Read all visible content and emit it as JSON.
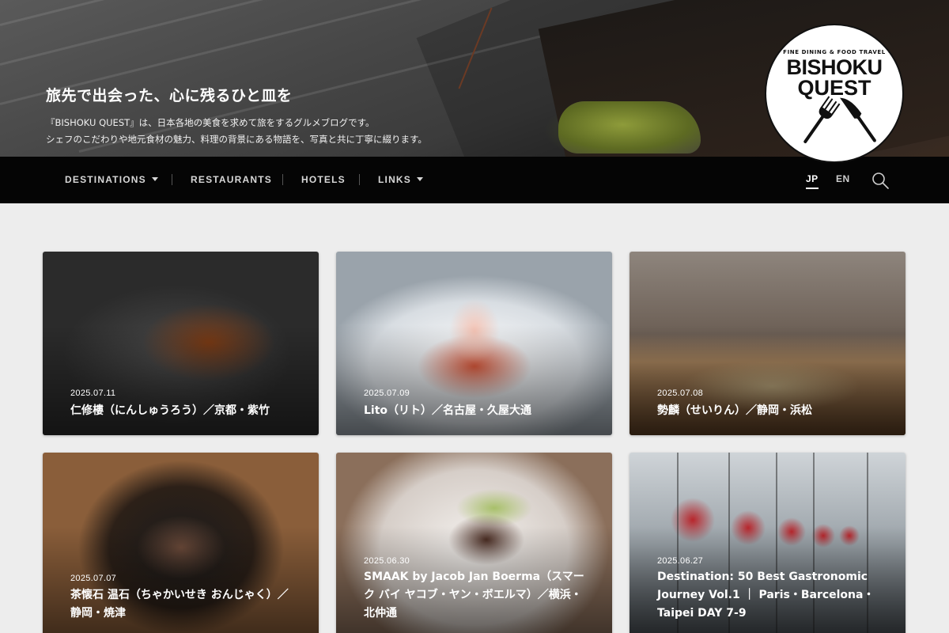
{
  "hero": {
    "title": "旅先で出会った、心に残るひと皿を",
    "desc_line1": "『BISHOKU QUEST』は、日本各地の美食を求めて旅をするグルメブログです。",
    "desc_line2": "シェフのこだわりや地元食材の魅力、料理の背景にある物語を、写真と共に丁寧に綴ります。"
  },
  "logo": {
    "tagline": "— FINE DINING & FOOD TRAVEL —",
    "line1": "BISHOKU",
    "line2": "QUEST"
  },
  "nav": {
    "items": [
      {
        "label": "DESTINATIONS",
        "has_dropdown": true
      },
      {
        "label": "RESTAURANTS",
        "has_dropdown": false
      },
      {
        "label": "HOTELS",
        "has_dropdown": false
      },
      {
        "label": "LINKS",
        "has_dropdown": true
      }
    ],
    "languages": [
      {
        "label": "JP",
        "active": true
      },
      {
        "label": "EN",
        "active": false
      }
    ],
    "search_icon": "search-icon"
  },
  "posts": [
    {
      "date": "2025.07.11",
      "title": "仁修樓（にんしゅうろう）／京都・紫竹"
    },
    {
      "date": "2025.07.09",
      "title": "Lito（リト）／名古屋・久屋大通"
    },
    {
      "date": "2025.07.08",
      "title": "勢麟（せいりん）／静岡・浜松"
    },
    {
      "date": "2025.07.07",
      "title": "茶懐石 温石（ちゃかいせき おんじゃく）／静岡・焼津"
    },
    {
      "date": "2025.06.30",
      "title": "SMAAK by Jacob Jan Boerma（スマーク バイ ヤコブ・ヤン・ボエルマ）／横浜・北仲通"
    },
    {
      "date": "2025.06.27",
      "title": "Destination: 50 Best Gastronomic Journey Vol.1 ｜ Paris・Barcelona・Taipei DAY 7-9"
    }
  ]
}
